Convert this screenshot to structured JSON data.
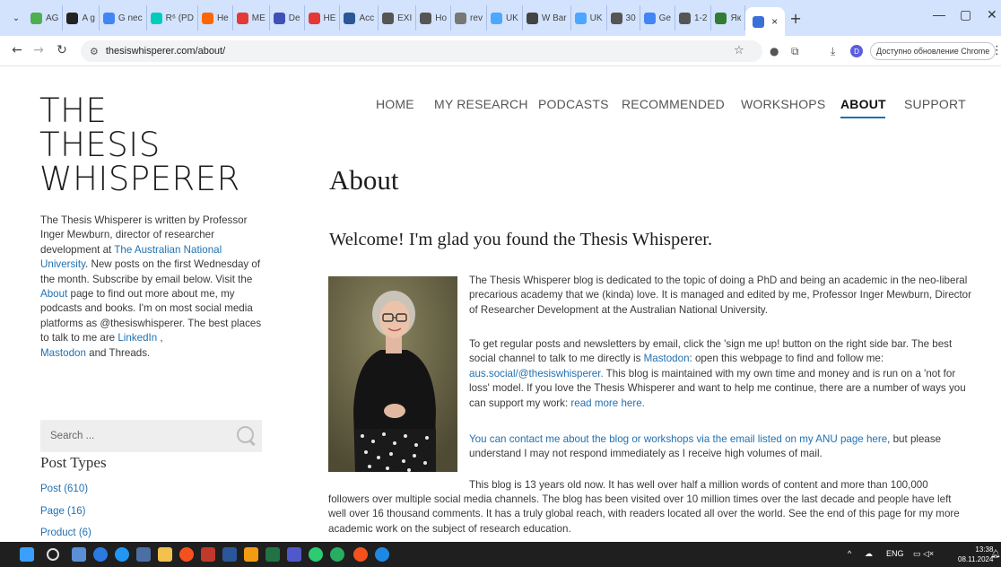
{
  "browser": {
    "tabs": [
      {
        "label": "AG",
        "color": "#4caf50"
      },
      {
        "label": "A g",
        "color": "#222222"
      },
      {
        "label": "G nec",
        "color": "#4285f4"
      },
      {
        "label": "R⁶ (PD",
        "color": "#00ccbb"
      },
      {
        "label": "He",
        "color": "#ff6600"
      },
      {
        "label": "ME",
        "color": "#e53935"
      },
      {
        "label": "De",
        "color": "#3f51b5"
      },
      {
        "label": "HE",
        "color": "#e53935"
      },
      {
        "label": "Acc",
        "color": "#2b5797"
      },
      {
        "label": "EXI",
        "color": "#555555"
      },
      {
        "label": "Ho",
        "color": "#555555"
      },
      {
        "label": "rev",
        "color": "#777777"
      },
      {
        "label": "UK",
        "color": "#4da6ff"
      },
      {
        "label": "W Bar",
        "color": "#444444"
      },
      {
        "label": "UK",
        "color": "#4da6ff"
      },
      {
        "label": "30",
        "color": "#555555"
      },
      {
        "label": "Ge",
        "color": "#4285f4"
      },
      {
        "label": "1-2",
        "color": "#555555"
      },
      {
        "label": "Як",
        "color": "#2e7d32"
      }
    ],
    "active_tab_close": "×",
    "new_tab": "+",
    "url": "thesiswhisperer.com/about/",
    "profile_letter": "D",
    "update_label": "Доступно обновление Chrome",
    "window_min": "—",
    "window_restore": "▢",
    "window_close": "✕"
  },
  "site": {
    "logo_line1": "THE",
    "logo_line2": "THESIS",
    "logo_line3": "WHISPERER",
    "nav": [
      {
        "label": "HOME",
        "active": false
      },
      {
        "label": "MY RESEARCH",
        "active": false
      },
      {
        "label": "PODCASTS",
        "active": false
      },
      {
        "label": "RECOMMENDED",
        "active": false
      },
      {
        "label": "WORKSHOPS",
        "active": false
      },
      {
        "label": "ABOUT",
        "active": true
      },
      {
        "label": "SUPPORT",
        "active": false
      }
    ],
    "sidebar": {
      "intro_1": "The Thesis Whisperer is written by Professor Inger Mewburn, director of researcher development at ",
      "intro_link_anu": "The Australian National University",
      "intro_2": ". New posts on the first Wednesday of the month. Subscribe by email below. Visit the ",
      "intro_link_about": "About",
      "intro_3": " page to find out more about me, my podcasts and books. I'm on most social media platforms as @thesiswhisperer. The best places to talk to me are ",
      "intro_link_linkedin": "LinkedIn",
      "intro_4": " ,",
      "intro_link_mastodon": "Mastodon",
      "intro_5": " and Threads.",
      "search_placeholder": "Search ...",
      "post_types_heading": "Post Types",
      "post_types": [
        "Post (610)",
        "Page (16)",
        "Product (6)"
      ]
    },
    "main": {
      "title": "About",
      "welcome": "Welcome! I'm glad you found the Thesis Whisperer.",
      "p1": "The Thesis Whisperer blog is dedicated to the topic of doing a PhD and being an academic in the neo-liberal precarious academy that we (kinda) love. It is managed and edited by me, Professor Inger Mewburn, Director of Researcher Development at the Australian National University.",
      "p2_a": "To get regular posts and newsletters by email, click the 'sign me up! button on the right side bar. The best social channel to talk to me directly is ",
      "p2_link_mastodon": "Mastodon",
      "p2_b": ": open this webpage to find and follow me: ",
      "p2_link_handle": "aus.social/@thesiswhisperer.",
      "p2_c": " This blog is maintained with my own time and money and is run on a 'not for loss' model. If you love the Thesis Whisperer and want to help me continue, there are a number of ways you can support my work: ",
      "p2_link_more": "read more here.",
      "p3_link": "You can contact me about the blog or workshops via the email listed on my ANU page here",
      "p3_rest": ", but please understand I may not respond immediately as I receive high volumes of mail.",
      "p4_start": "This blog is 13 years old now. It has well over half a million words of content and more than 100,000",
      "p4_rest": "followers over multiple social media channels. The blog has been visited over 10 million times over the last decade and people have left well over 16 thousand comments. It has a truly global reach, with readers located all over the world. See the end of this page for my more academic work on the subject of research education."
    }
  },
  "taskbar": {
    "lang": "ENG",
    "time": "13:38",
    "date": "08.11.2024"
  },
  "colors": {
    "link": "#2271b1",
    "nav_underline": "#1f6fb2",
    "tabstrip": "#d3e3fd",
    "taskbar": "#1f1f1f"
  }
}
